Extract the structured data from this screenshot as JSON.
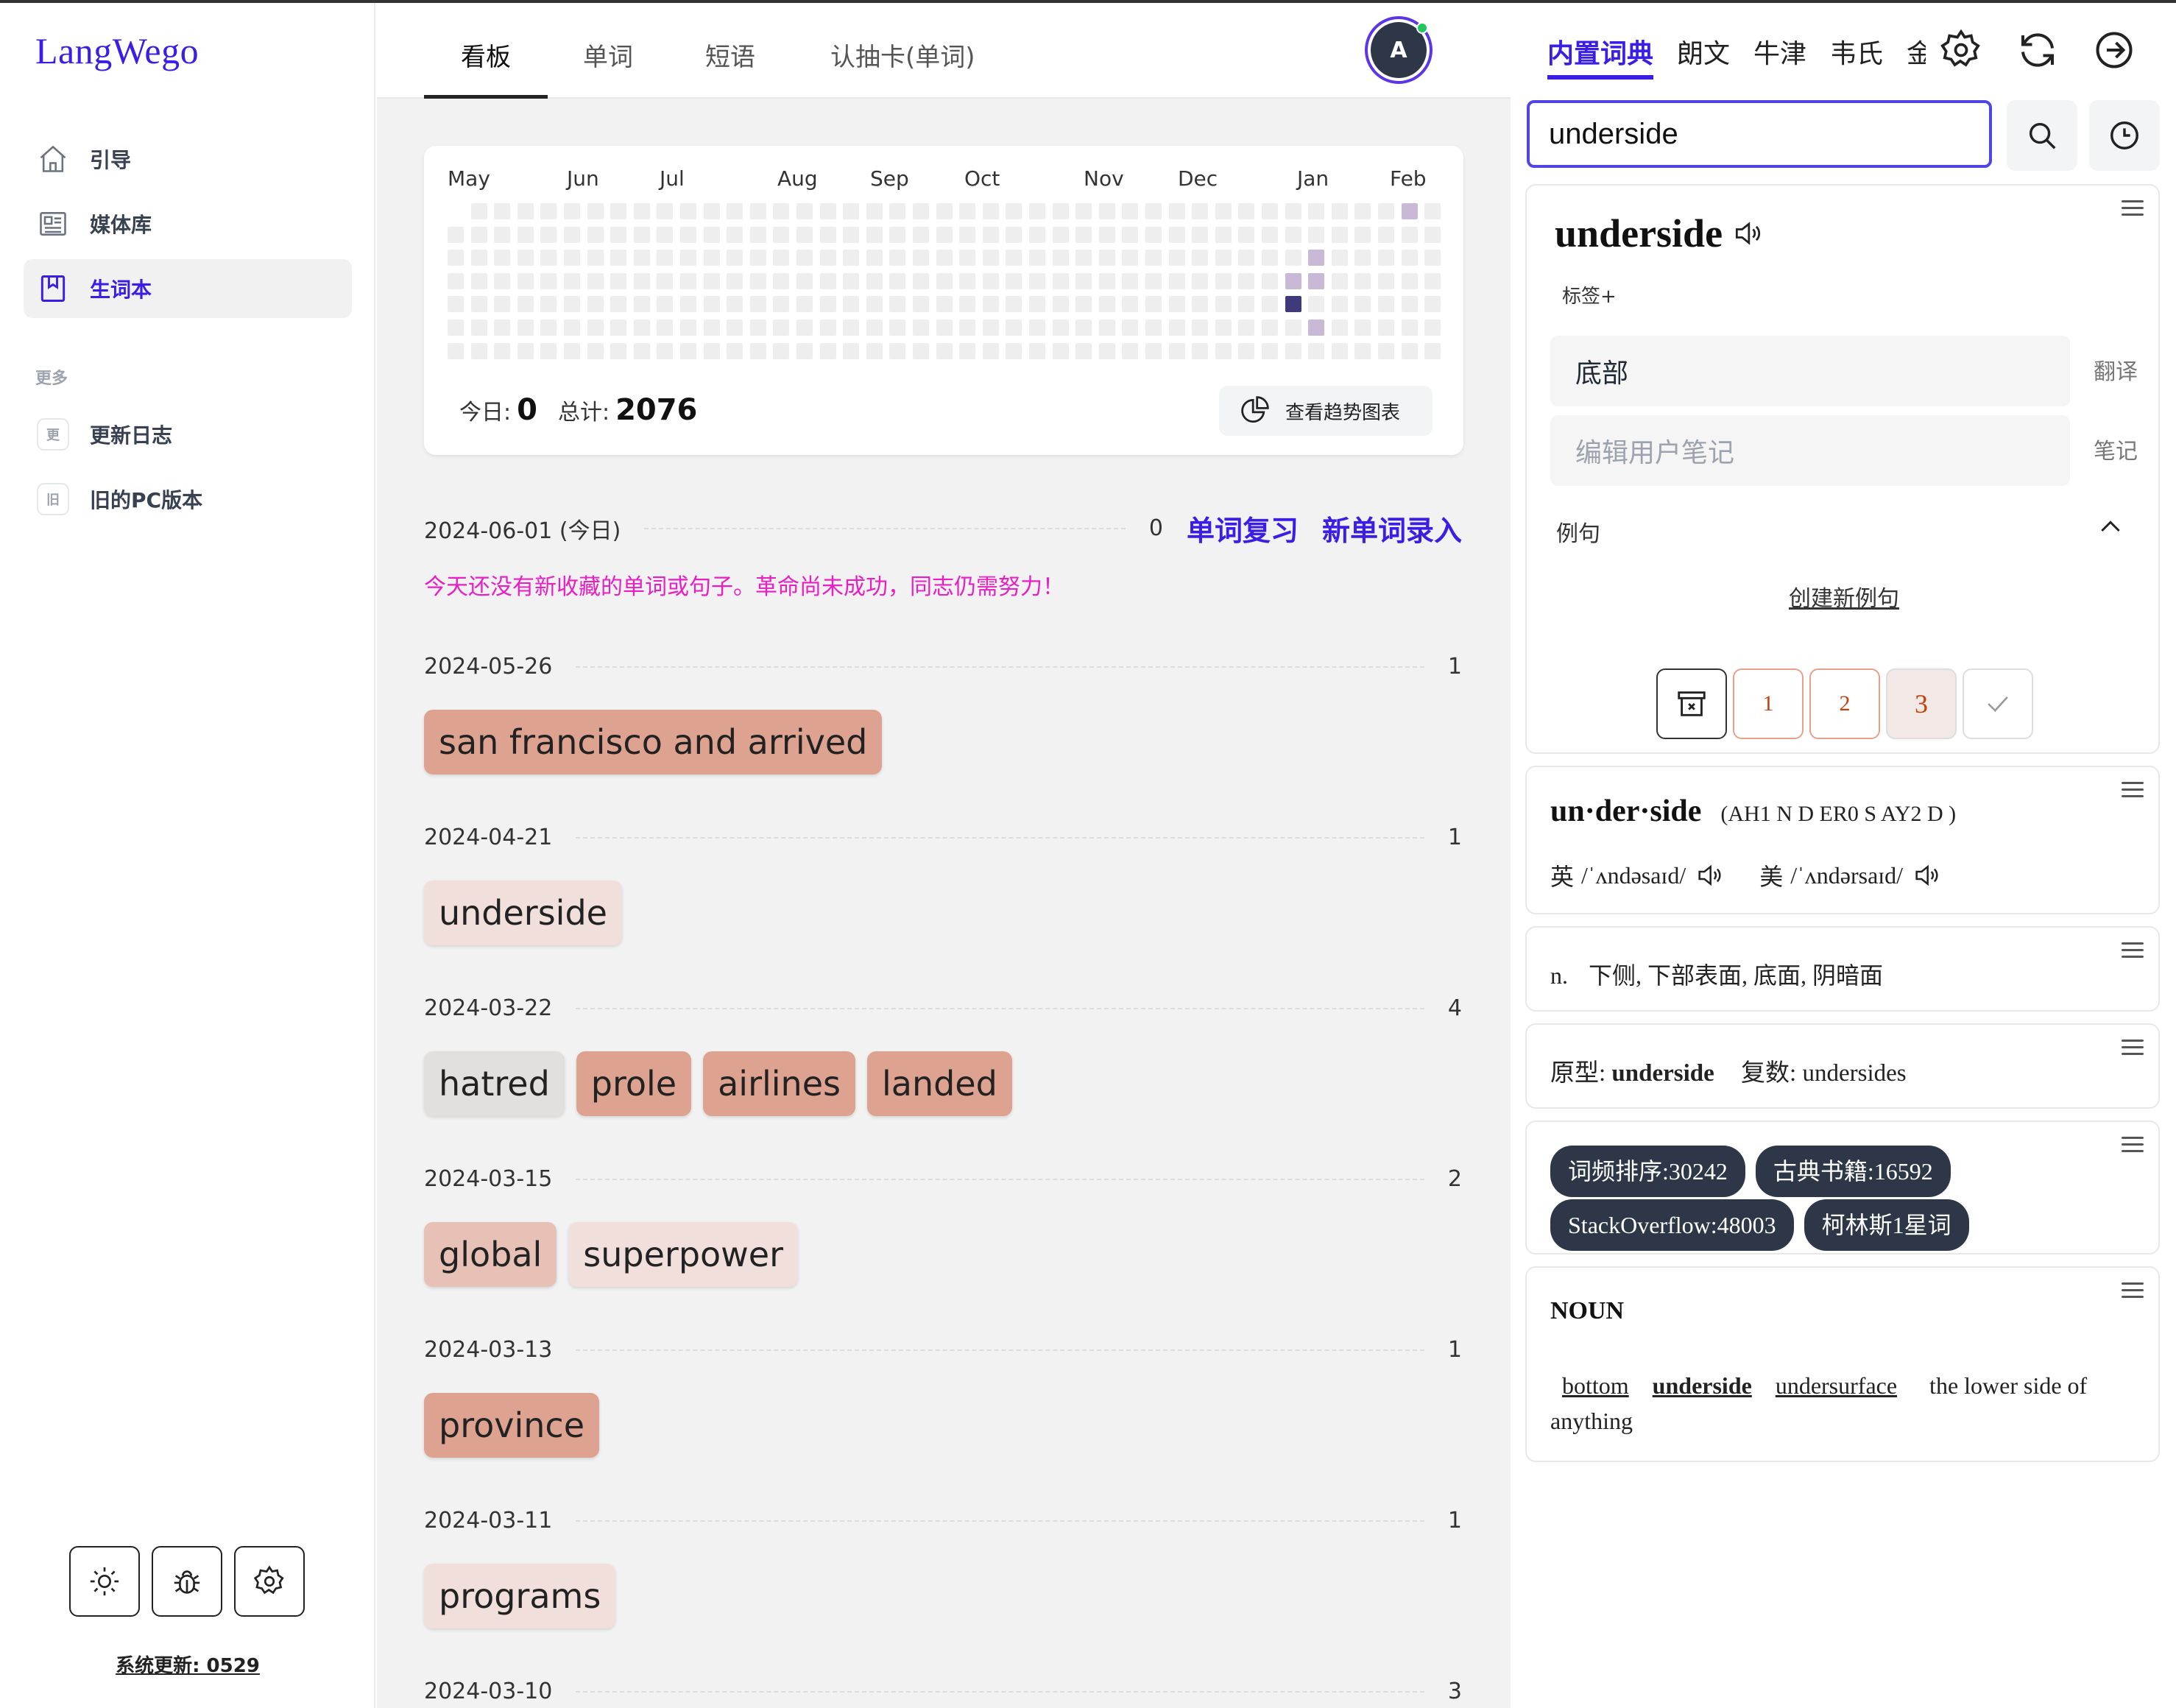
{
  "sidebar": {
    "logo": "LangWego",
    "items": [
      {
        "label": "引导",
        "icon": "home-icon"
      },
      {
        "label": "媒体库",
        "icon": "newspaper-icon"
      },
      {
        "label": "生词本",
        "icon": "bookmark-icon"
      }
    ],
    "section_label": "更多",
    "more_items": [
      {
        "badge": "更",
        "label": "更新日志"
      },
      {
        "badge": "旧",
        "label": "旧的PC版本"
      }
    ],
    "bottom_buttons": [
      "sun-icon",
      "bug-icon",
      "gear-icon"
    ],
    "system_update": "系统更新: 0529"
  },
  "main": {
    "tabs": [
      "看板",
      "单词",
      "短语",
      "认抽卡(单词)"
    ],
    "active_tab": "看板",
    "avatar_letter": "A",
    "heatmap": {
      "months": [
        "May",
        "Jun",
        "Jul",
        "Aug",
        "Sep",
        "Oct",
        "Nov",
        "Dec",
        "Jan",
        "Feb"
      ],
      "today_label": "今日:",
      "today_value": "0",
      "total_label": "总计:",
      "total_value": "2076",
      "trend_button": "查看趋势图表"
    },
    "today": {
      "date": "2024-06-01 (今日)",
      "count": "0",
      "review_link": "单词复习",
      "new_link": "新单词录入",
      "message": "今天还没有新收藏的单词或句子。革命尚未成功，同志仍需努力！"
    },
    "days": [
      {
        "date": "2024-05-26",
        "count": "1",
        "words": [
          {
            "text": "san francisco and arrived",
            "color": "#dea390"
          }
        ]
      },
      {
        "date": "2024-04-21",
        "count": "1",
        "words": [
          {
            "text": "underside",
            "color": "#f0dfdb"
          }
        ]
      },
      {
        "date": "2024-03-22",
        "count": "4",
        "words": [
          {
            "text": "hatred",
            "color": "#e2e0df"
          },
          {
            "text": "prole",
            "color": "#dea390"
          },
          {
            "text": "airlines",
            "color": "#dea390"
          },
          {
            "text": "landed",
            "color": "#dea390"
          }
        ]
      },
      {
        "date": "2024-03-15",
        "count": "2",
        "words": [
          {
            "text": "global",
            "color": "#e7c1b5"
          },
          {
            "text": "superpower",
            "color": "#f0dfdb"
          }
        ]
      },
      {
        "date": "2024-03-13",
        "count": "1",
        "words": [
          {
            "text": "province",
            "color": "#dea390"
          }
        ]
      },
      {
        "date": "2024-03-11",
        "count": "1",
        "words": [
          {
            "text": "programs",
            "color": "#f0dfdb"
          }
        ]
      },
      {
        "date": "2024-03-10",
        "count": "3",
        "words": []
      }
    ]
  },
  "right": {
    "tabs": [
      "内置词典",
      "朗文",
      "牛津",
      "韦氏",
      "金"
    ],
    "active_tab": "内置词典",
    "search_value": "underside",
    "entry": {
      "word": "underside",
      "tag_button": "标签+",
      "translation": "底部",
      "translation_side": "翻译",
      "note_placeholder": "编辑用户笔记",
      "note_side": "笔记",
      "examples_label": "例句",
      "create_example": "创建新例句",
      "ratings": [
        "1",
        "2",
        "3"
      ]
    },
    "pron": {
      "syll": "un·der·side",
      "arpabet": "(AH1 N D ER0 S AY2 D )",
      "uk_label": "英",
      "uk_ipa": "/ˈʌndəsaɪd/",
      "us_label": "美",
      "us_ipa": "/ˈʌndərsaɪd/"
    },
    "definition": {
      "pos": "n.",
      "text": "下侧, 下部表面, 底面, 阴暗面"
    },
    "forms": {
      "base_label": "原型:",
      "base": "underside",
      "plural_label": "复数:",
      "plural": "undersides"
    },
    "tags": [
      "词频排序:30242",
      "古典书籍:16592",
      "StackOverflow:48003",
      "柯林斯1星词"
    ],
    "wordnet": {
      "pos": "NOUN",
      "synonyms": [
        "bottom",
        "underside",
        "undersurface"
      ],
      "gloss": "the lower side of anything"
    }
  }
}
